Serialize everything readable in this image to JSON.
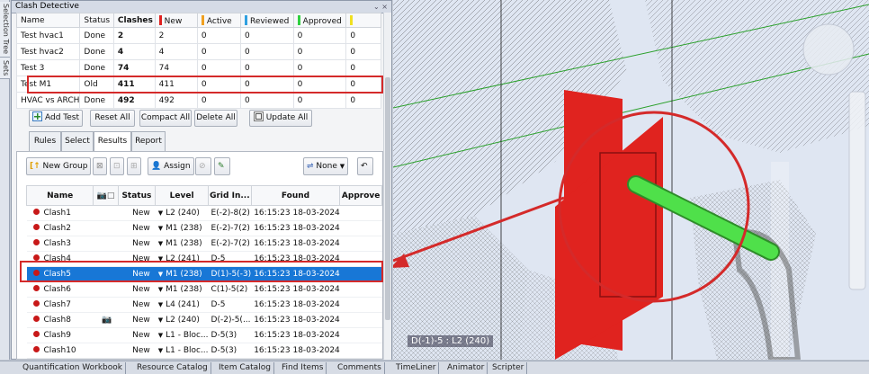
{
  "side_tabs": [
    "Selection Tree",
    "Sets"
  ],
  "panel": {
    "title": "Clash Detective",
    "title_controls": "⌄ ×"
  },
  "tests_table": {
    "headers": [
      "Name",
      "Status",
      "Clashes",
      "New",
      "Active",
      "Reviewed",
      "Approved"
    ],
    "header_colors": {
      "New": "#e0201f",
      "Active": "#f0a020",
      "Reviewed": "#30a0e0",
      "Approved": "#30d040",
      "Resolved": "#f0e020"
    },
    "rows": [
      {
        "name": "Test hvac1",
        "status": "Done",
        "clashes": "2",
        "new": "2",
        "active": "0",
        "reviewed": "0",
        "approved": "0"
      },
      {
        "name": "Test hvac2",
        "status": "Done",
        "clashes": "4",
        "new": "4",
        "active": "0",
        "reviewed": "0",
        "approved": "0"
      },
      {
        "name": "Test 3",
        "status": "Done",
        "clashes": "74",
        "new": "74",
        "active": "0",
        "reviewed": "0",
        "approved": "0"
      },
      {
        "name": "Test M1",
        "status": "Old",
        "clashes": "411",
        "new": "411",
        "active": "0",
        "reviewed": "0",
        "approved": "0"
      },
      {
        "name": "HVAC vs ARCH",
        "status": "Done",
        "clashes": "492",
        "new": "492",
        "active": "0",
        "reviewed": "0",
        "approved": "0"
      }
    ]
  },
  "test_buttons": {
    "add_test": "Add Test",
    "reset_all": "Reset All",
    "compact_all": "Compact All",
    "delete_all": "Delete All",
    "update_all": "Update All"
  },
  "tabs": [
    "Rules",
    "Select",
    "Results",
    "Report"
  ],
  "active_tab": "Results",
  "results_toolbar": {
    "new_group": "New Group",
    "assign": "Assign",
    "none": "None"
  },
  "clash_table": {
    "headers": [
      "Name",
      "",
      "Status",
      "Level",
      "Grid In...",
      "Found",
      "Approve"
    ],
    "rows": [
      {
        "name": "Clash1",
        "icon": "",
        "status": "New",
        "level": "L2 (240)",
        "grid": "E(-2)-8(2)",
        "found": "16:15:23 18-03-2024"
      },
      {
        "name": "Clash2",
        "icon": "",
        "status": "New",
        "level": "M1 (238)",
        "grid": "E(-2)-7(2)",
        "found": "16:15:23 18-03-2024"
      },
      {
        "name": "Clash3",
        "icon": "",
        "status": "New",
        "level": "M1 (238)",
        "grid": "E(-2)-7(2)",
        "found": "16:15:23 18-03-2024"
      },
      {
        "name": "Clash4",
        "icon": "",
        "status": "New",
        "level": "L2 (241)",
        "grid": "D-5",
        "found": "16:15:23 18-03-2024"
      },
      {
        "name": "Clash5",
        "icon": "",
        "status": "New",
        "level": "M1 (238)",
        "grid": "D(1)-5(-3)",
        "found": "16:15:23 18-03-2024"
      },
      {
        "name": "Clash6",
        "icon": "",
        "status": "New",
        "level": "M1 (238)",
        "grid": "C(1)-5(2)",
        "found": "16:15:23 18-03-2024"
      },
      {
        "name": "Clash7",
        "icon": "",
        "status": "New",
        "level": "L4 (241)",
        "grid": "D-5",
        "found": "16:15:23 18-03-2024"
      },
      {
        "name": "Clash8",
        "icon": "camera",
        "status": "New",
        "level": "L2 (240)",
        "grid": "D(-2)-5(...",
        "found": "16:15:23 18-03-2024"
      },
      {
        "name": "Clash9",
        "icon": "",
        "status": "New",
        "level": "L1 - Bloc...",
        "grid": "D-5(3)",
        "found": "16:15:23 18-03-2024"
      },
      {
        "name": "Clash10",
        "icon": "",
        "status": "New",
        "level": "L1 - Bloc...",
        "grid": "D-5(3)",
        "found": "16:15:23 18-03-2024"
      }
    ],
    "selected_row": "Clash5"
  },
  "viewport": {
    "label": "D(-1)-5 : L2 (240)",
    "pipe_color": "#4fe04a",
    "wall_color": "#e0231f",
    "highlight_color": "#d42a2a"
  },
  "bottom_tabs": [
    "Quantification Workbook",
    "Resource Catalog",
    "Item Catalog",
    "Find Items",
    "Comments",
    "TimeLiner",
    "Animator",
    "Scripter"
  ]
}
